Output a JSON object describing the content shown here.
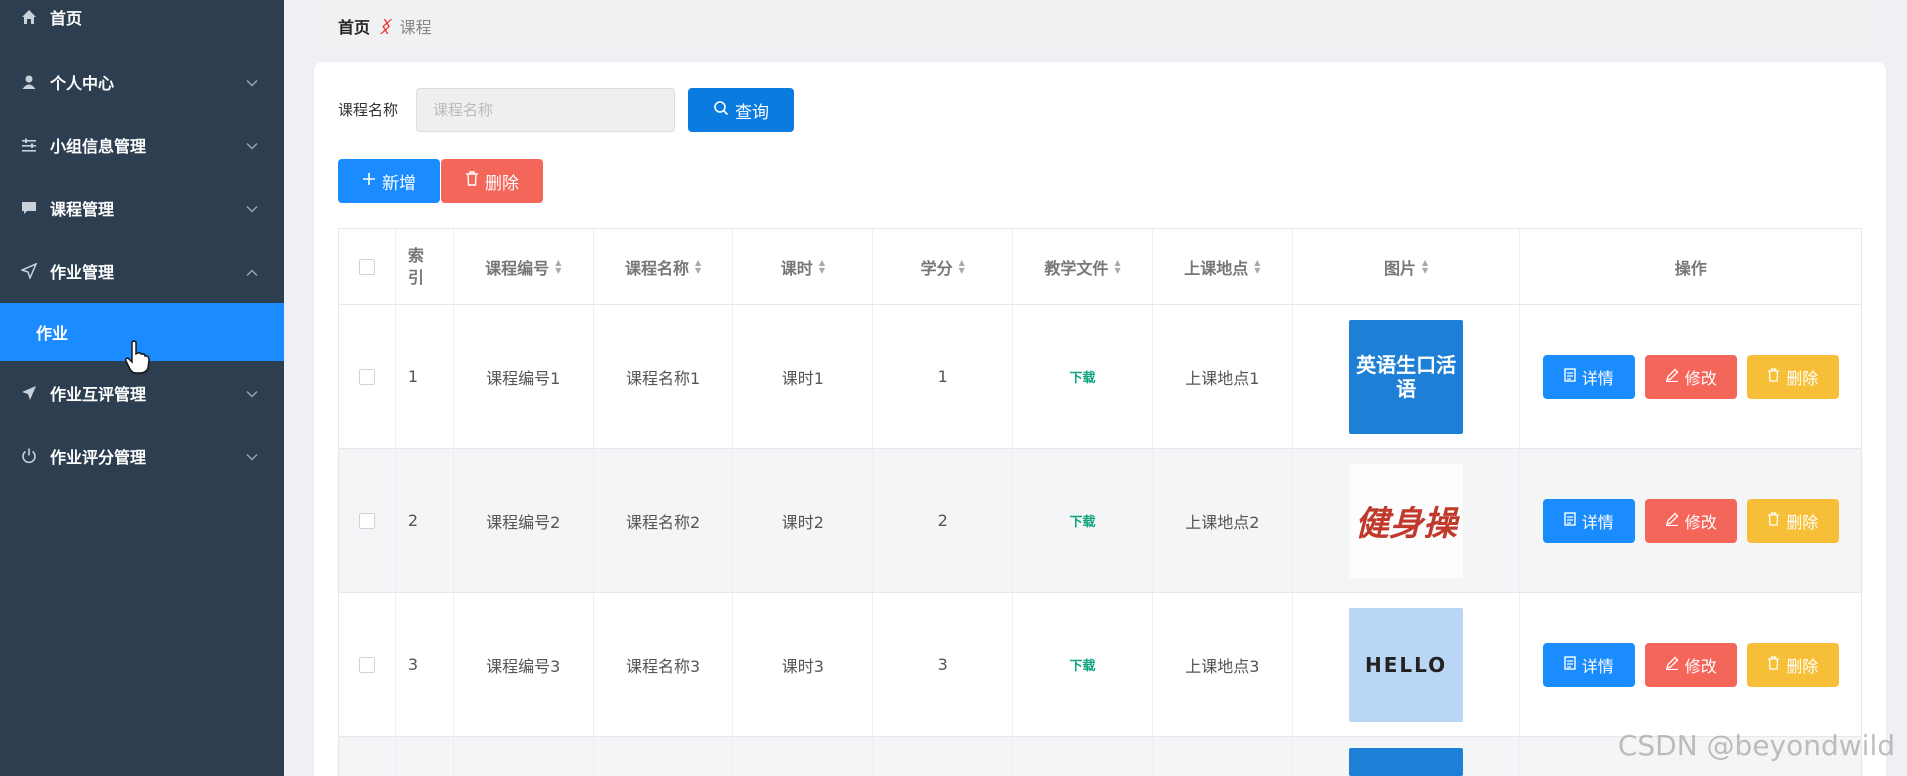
{
  "sidebar": {
    "items": [
      {
        "label": "首页",
        "icon": "home-icon"
      },
      {
        "label": "个人中心",
        "icon": "user-icon"
      },
      {
        "label": "小组信息管理",
        "icon": "sliders-icon"
      },
      {
        "label": "课程管理",
        "icon": "chat-icon"
      },
      {
        "label": "作业管理",
        "icon": "send-icon"
      },
      {
        "label": "作业互评管理",
        "icon": "send-icon"
      },
      {
        "label": "作业评分管理",
        "icon": "power-icon"
      }
    ],
    "active_sub": "作业"
  },
  "breadcrumb": {
    "home": "首页",
    "current": "课程"
  },
  "search": {
    "label": "课程名称",
    "placeholder": "课程名称",
    "button": "查询"
  },
  "toolbar": {
    "add": "新增",
    "delete": "删除"
  },
  "table": {
    "headers": [
      "索引",
      "课程编号",
      "课程名称",
      "课时",
      "学分",
      "教学文件",
      "上课地点",
      "图片",
      "操作"
    ],
    "rows": [
      {
        "index": "1",
        "code": "课程编号1",
        "name": "课程名称1",
        "hours": "课时1",
        "credit": "1",
        "file": "下载",
        "place": "上课地点1",
        "image_text": "英语生口活语"
      },
      {
        "index": "2",
        "code": "课程编号2",
        "name": "课程名称2",
        "hours": "课时2",
        "credit": "2",
        "file": "下载",
        "place": "上课地点2",
        "image_text": "健身操"
      },
      {
        "index": "3",
        "code": "课程编号3",
        "name": "课程名称3",
        "hours": "课时3",
        "credit": "3",
        "file": "下载",
        "place": "上课地点3",
        "image_text": "HELLO"
      }
    ],
    "actions": {
      "detail": "详情",
      "edit": "修改",
      "delete": "删除"
    }
  },
  "watermark": "CSDN @beyondwild",
  "colors": {
    "sidebar": "#2c3e50",
    "primary": "#1a8cff",
    "danger": "#f5665a",
    "warning": "#f7be38",
    "download": "#0fa37f"
  }
}
